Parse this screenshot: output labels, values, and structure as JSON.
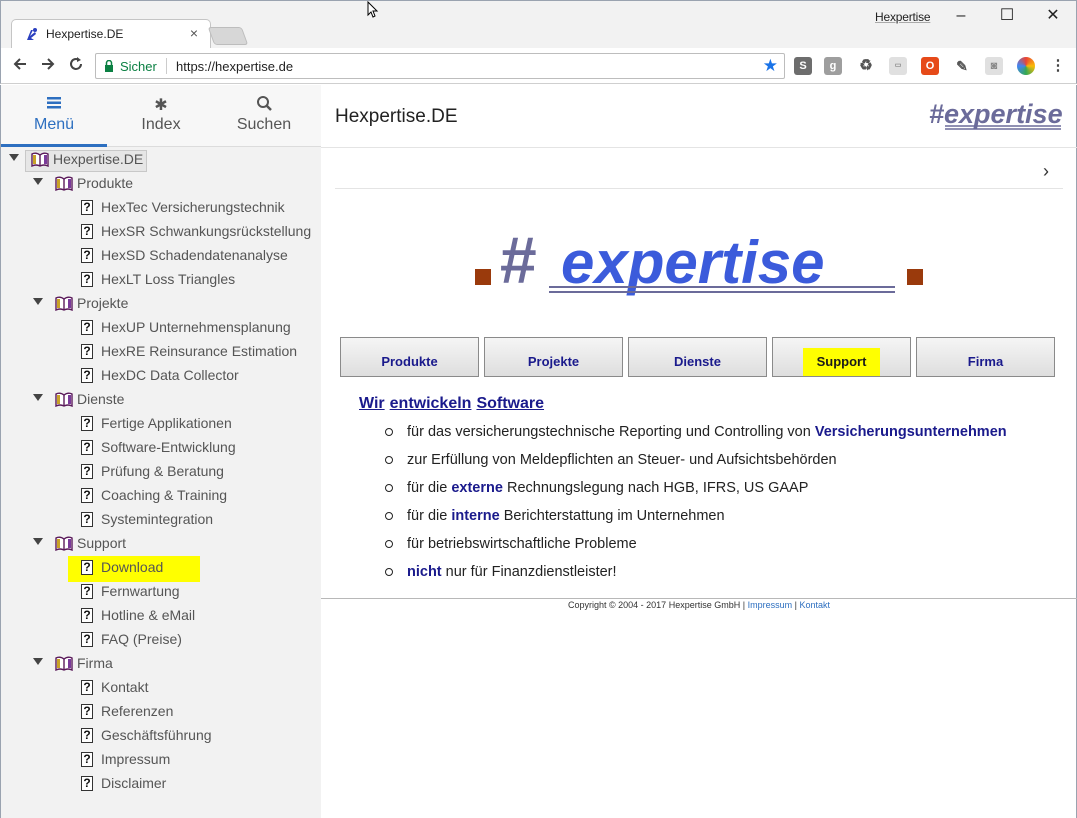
{
  "browser": {
    "tab_title": "Hexpertise.DE",
    "tab_close": "×",
    "window_title": "Hexpertise",
    "secure_label": "Sicher",
    "url": "https://hexpertise.de",
    "minimize": "–",
    "maximize": "☐",
    "close": "✕"
  },
  "sidebar": {
    "tabs": [
      {
        "label": "Menü",
        "icon": "list-icon"
      },
      {
        "label": "Index",
        "icon": "asterisk-icon"
      },
      {
        "label": "Suchen",
        "icon": "search-icon"
      }
    ],
    "tree": [
      {
        "label": "Hexpertise.DE",
        "level": 0,
        "kind": "book"
      },
      {
        "label": "Produkte",
        "level": 1,
        "kind": "book"
      },
      {
        "label": "HexTec Versicherungstechnik",
        "level": 2,
        "kind": "page"
      },
      {
        "label": "HexSR Schwankungsrückstellung",
        "level": 2,
        "kind": "page"
      },
      {
        "label": "HexSD Schadendatenanalyse",
        "level": 2,
        "kind": "page"
      },
      {
        "label": "HexLT Loss Triangles",
        "level": 2,
        "kind": "page"
      },
      {
        "label": "Projekte",
        "level": 1,
        "kind": "book"
      },
      {
        "label": "HexUP Unternehmensplanung",
        "level": 2,
        "kind": "page"
      },
      {
        "label": "HexRE Reinsurance Estimation",
        "level": 2,
        "kind": "page"
      },
      {
        "label": "HexDC Data Collector",
        "level": 2,
        "kind": "page"
      },
      {
        "label": "Dienste",
        "level": 1,
        "kind": "book"
      },
      {
        "label": "Fertige Applikationen",
        "level": 2,
        "kind": "page"
      },
      {
        "label": "Software-Entwicklung",
        "level": 2,
        "kind": "page"
      },
      {
        "label": "Prüfung & Beratung",
        "level": 2,
        "kind": "page"
      },
      {
        "label": "Coaching & Training",
        "level": 2,
        "kind": "page"
      },
      {
        "label": "Systemintegration",
        "level": 2,
        "kind": "page"
      },
      {
        "label": "Support",
        "level": 1,
        "kind": "book"
      },
      {
        "label": "Download",
        "level": 2,
        "kind": "page",
        "highlight": true
      },
      {
        "label": "Fernwartung",
        "level": 2,
        "kind": "page"
      },
      {
        "label": "Hotline & eMail",
        "level": 2,
        "kind": "page"
      },
      {
        "label": "FAQ (Preise)",
        "level": 2,
        "kind": "page"
      },
      {
        "label": "Firma",
        "level": 1,
        "kind": "book"
      },
      {
        "label": "Kontakt",
        "level": 2,
        "kind": "page"
      },
      {
        "label": "Referenzen",
        "level": 2,
        "kind": "page"
      },
      {
        "label": "Geschäftsführung",
        "level": 2,
        "kind": "page"
      },
      {
        "label": "Impressum",
        "level": 2,
        "kind": "page"
      },
      {
        "label": "Disclaimer",
        "level": 2,
        "kind": "page"
      }
    ]
  },
  "main": {
    "title": "Hexpertise.DE",
    "chevron": "›",
    "logo_text": "#expertise",
    "nav_buttons": [
      {
        "label": "Produkte"
      },
      {
        "label": "Projekte"
      },
      {
        "label": "Dienste"
      },
      {
        "label": "Support",
        "highlight": true
      },
      {
        "label": "Firma"
      }
    ],
    "headline": [
      "Wir",
      "entwickeln",
      "Software"
    ],
    "bullets": [
      {
        "text": "für das versicherungstechnische Reporting und Controlling von ",
        "bold": "Versicherungsunternehmen",
        "after": ""
      },
      {
        "text": "zur Erfüllung von Meldepflichten an Steuer- und Aufsichtsbehörden",
        "bold": "",
        "after": ""
      },
      {
        "text": "für die ",
        "bold": "externe",
        "after": " Rechnungslegung nach HGB, IFRS, US GAAP"
      },
      {
        "text": "für die ",
        "bold": "interne",
        "after": " Berichterstattung im Unternehmen"
      },
      {
        "text": "für betriebswirtschaftliche Probleme",
        "bold": "",
        "after": ""
      },
      {
        "text": "",
        "bold": "nicht",
        "after": " nur für Finanzdienstleister!"
      }
    ],
    "footer": {
      "copyright": "Copyright © 2004 - 2017 Hexpertise GmbH |",
      "impressum": "Impressum",
      "separator": "|",
      "kontakt": "Kontakt"
    }
  },
  "colors": {
    "accent": "#2d6fc0",
    "highlight": "#ffff00",
    "link_dark": "#1a1a8c",
    "logo_blue": "#3b5bdb",
    "logo_gray": "#6b6b9a",
    "logo_square": "#9a3a0c"
  }
}
